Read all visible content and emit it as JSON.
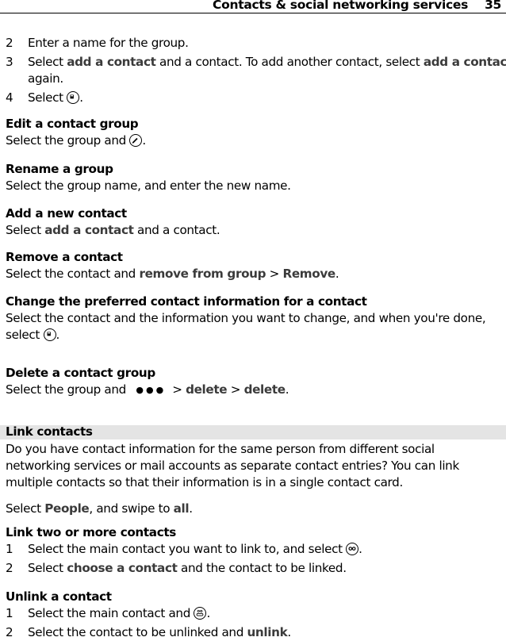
{
  "header": {
    "title": "Contacts & social networking services",
    "page": "35"
  },
  "create_group_steps": [
    {
      "num": "2",
      "text": "Enter a name for the group."
    },
    {
      "num": "3",
      "pre": "Select ",
      "ui": "add a contact",
      "mid": " and a contact. To add another contact, select ",
      "ui2": "add a contact",
      "cont": "again."
    },
    {
      "num": "4",
      "pre": "Select ",
      "icon": "save-icon",
      "post": "."
    }
  ],
  "edit_group": {
    "heading": "Edit a contact group",
    "pre": "Select the group and ",
    "icon": "edit-icon",
    "post": "."
  },
  "rename_group": {
    "heading": "Rename a group",
    "text": "Select the group name, and enter the new name."
  },
  "add_contact": {
    "heading": "Add a new contact",
    "pre": "Select ",
    "ui": "add a contact",
    "post": " and a contact."
  },
  "remove_contact": {
    "heading": "Remove a contact",
    "pre": "Select the contact and ",
    "ui": "remove from group",
    "sep": " > ",
    "ui2": "Remove",
    "post": "."
  },
  "change_preferred": {
    "heading": "Change the preferred contact information for a contact",
    "line1": "Select the contact and the information you want to change, and when you're done,",
    "pre2": "select ",
    "icon": "save-icon",
    "post2": "."
  },
  "delete_group": {
    "heading": "Delete a contact group",
    "pre": "Select the group and ",
    "icon": "more-dots-icon",
    "sep1": "> ",
    "ui": "delete",
    "sep2": " > ",
    "ui2": "delete",
    "post": "."
  },
  "link_section": {
    "title": "Link contacts",
    "intro": [
      "Do you have contact information for the same person from different social",
      "networking services or mail accounts as separate contact entries? You can link",
      "multiple contacts so that their information is in a single contact card."
    ],
    "select": {
      "pre": "Select ",
      "ui": "People",
      "mid": ", and swipe to ",
      "ui2": "all",
      "post": "."
    }
  },
  "link_two": {
    "heading": "Link two or more contacts",
    "steps": [
      {
        "num": "1",
        "pre": "Select the main contact you want to link to, and select ",
        "icon": "link-icon",
        "post": "."
      },
      {
        "num": "2",
        "pre": "Select ",
        "ui": "choose a contact",
        "post": " and the contact to be linked."
      }
    ]
  },
  "unlink": {
    "heading": "Unlink a contact",
    "steps": [
      {
        "num": "1",
        "pre": "Select the main contact and ",
        "icon": "linked-contacts-icon",
        "post": "."
      },
      {
        "num": "2",
        "pre": "Select the contact to be unlinked and ",
        "ui": "unlink",
        "post": "."
      }
    ]
  }
}
